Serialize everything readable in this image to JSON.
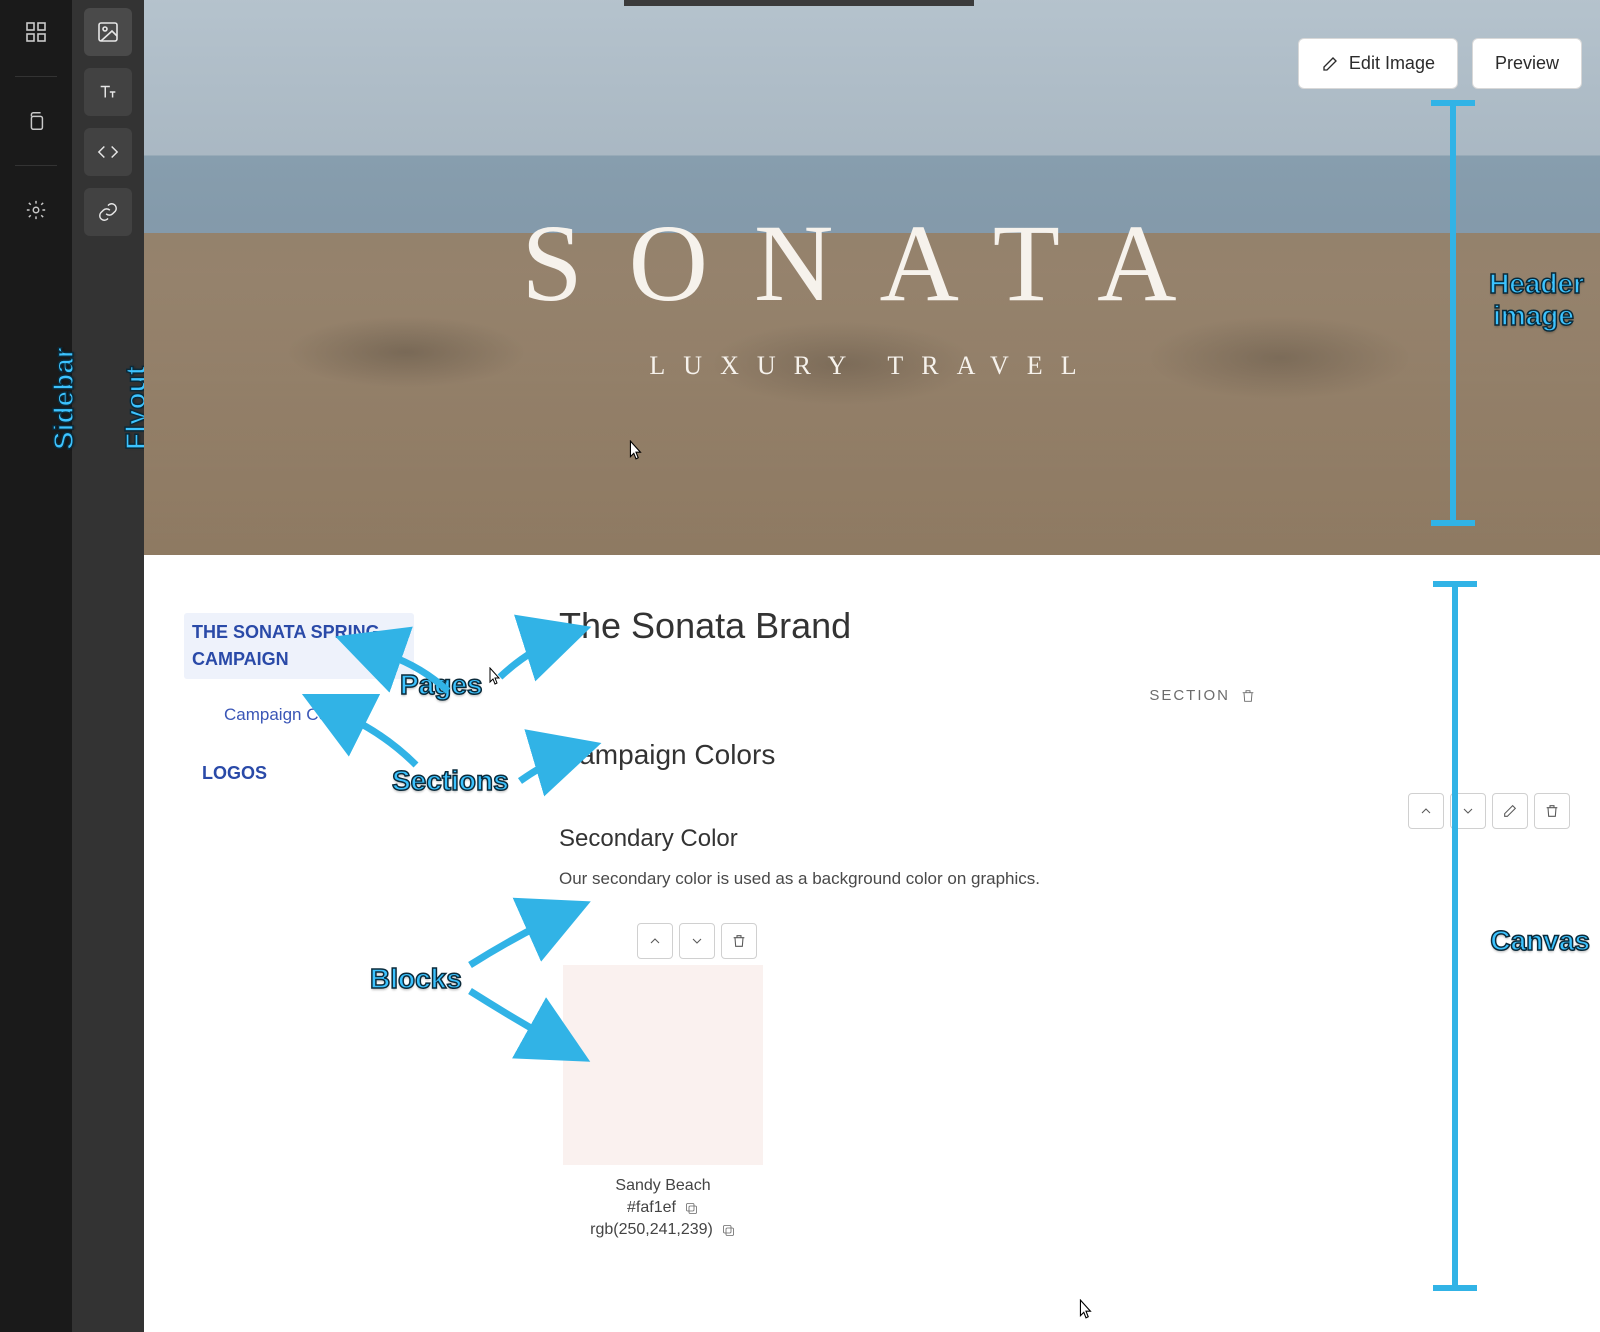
{
  "sidebar_label": "Sidebar",
  "flyout_label": "Flyout",
  "header_label_line1": "Header",
  "header_label_line2": "image",
  "canvas_label": "Canvas",
  "pages_callout": "Pages",
  "sections_callout": "Sections",
  "blocks_callout": "Blocks",
  "hero": {
    "brand_word": "SONATA",
    "brand_tag": "LUXURY TRAVEL"
  },
  "hero_actions": {
    "edit": "Edit Image",
    "preview": "Preview"
  },
  "nav": {
    "page1": "THE SONATA SPRING CAMPAIGN",
    "section1": "Campaign Colors",
    "page2": "LOGOS"
  },
  "content": {
    "title": "The Sonata Brand",
    "section_badge": "SECTION",
    "section_heading": "Campaign Colors",
    "block_heading": "Secondary Color",
    "block_desc": "Our secondary color is used as a background color on graphics.",
    "swatch_name": "Sandy Beach",
    "swatch_hex": "#faf1ef",
    "swatch_rgb": "rgb(250,241,239)"
  }
}
